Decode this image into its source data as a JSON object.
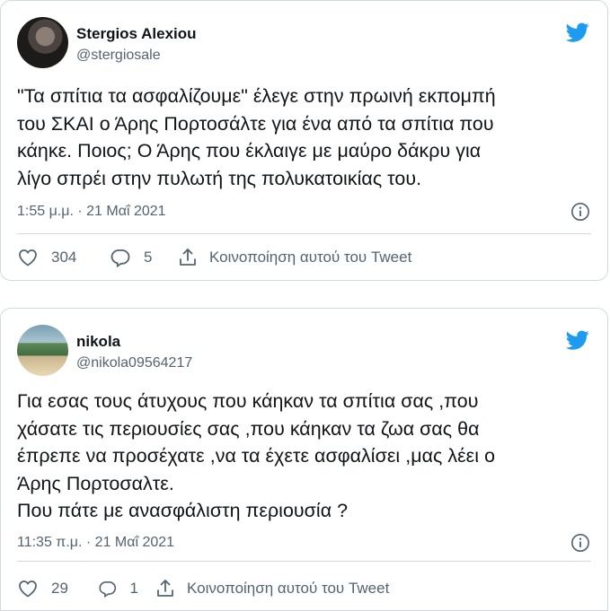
{
  "tweets": [
    {
      "name": "Stergios Alexiou",
      "handle": "@stergiosale",
      "text": "\"Τα σπίτια τα ασφαλίζουμε\" έλεγε στην πρωινή εκπομπή\nτου ΣΚΑΙ ο Άρης Πορτοσάλτε για ένα από τα σπίτια που\nκάηκε. Ποιος; Ο Άρης που έκλαιγε με μαύρο δάκρυ για\nλίγο σπρέι στην πυλωτή της πολυκατοικίας του.",
      "timestamp": "1:55 μ.μ. · 21 Μαΐ 2021",
      "likes": "304",
      "replies": "5",
      "share_label": "Κοινοποίηση αυτού του Tweet"
    },
    {
      "name": "nikola",
      "handle": "@nikola09564217",
      "text": "Για εσας τους άτυχους που κάηκαν τα σπίτια σας ,που\nχάσατε τις περιουσίες σας ,που κάηκαν τα ζωα σας θα\nέπρεπε να προσέχατε ,να τα έχετε ασφαλίσει ,μας λέει ο\nΆρης Πορτοσαλτε.\nΠου πάτε με ανασφάλιστη περιουσία ?",
      "timestamp": "11:35 π.μ. · 21 Μαΐ 2021",
      "likes": "29",
      "replies": "1",
      "share_label": "Κοινοποίηση αυτού του Tweet"
    }
  ],
  "colors": {
    "twitter_blue": "#1d9bf0",
    "muted": "#536471",
    "border": "#cfd9de"
  },
  "icons": [
    "twitter-bird-icon",
    "info-icon",
    "heart-icon",
    "reply-icon",
    "share-icon"
  ]
}
